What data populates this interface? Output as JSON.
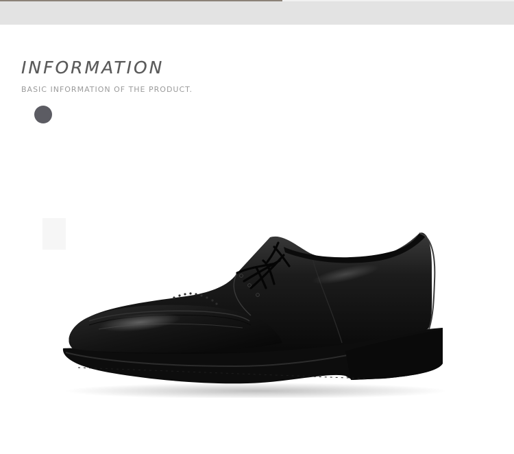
{
  "header": {
    "title": "INFORMATION",
    "subtitle": "BASIC INFORMATION OF THE PRODUCT."
  },
  "product": {
    "image_name": "black-leather-derby-shoe"
  },
  "colors": {
    "background": "#ffffff",
    "top_strip": "#e3e3e3",
    "title_text": "#5a5a5a",
    "subtitle_text": "#9a9a9a",
    "dot": "#5c5c63",
    "shoe": "#141414"
  }
}
